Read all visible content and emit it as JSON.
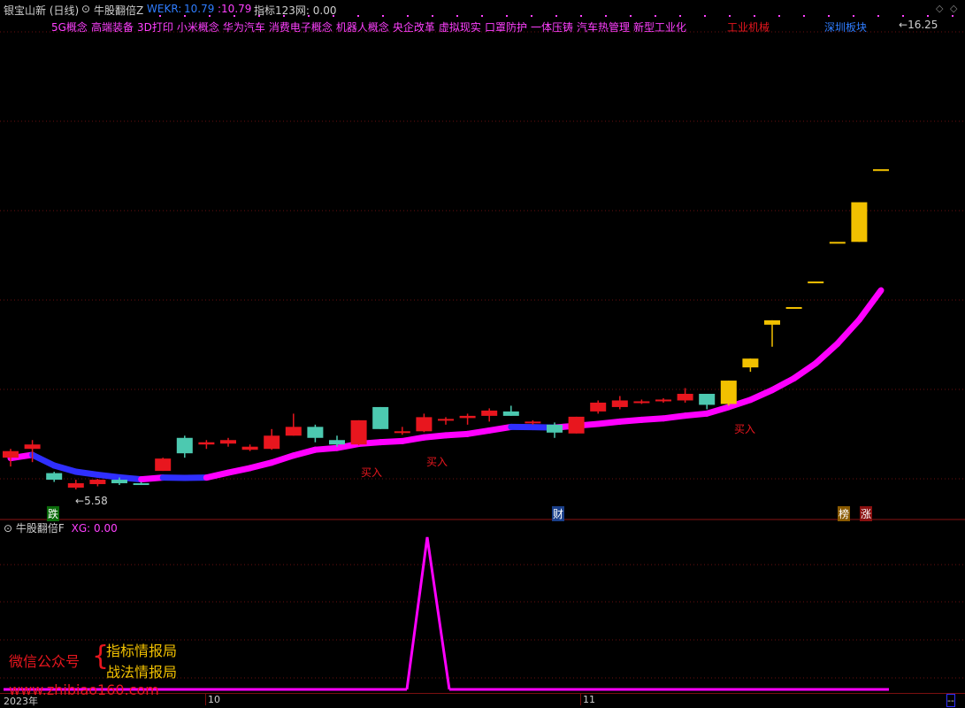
{
  "header": {
    "title": "银宝山新 (日线)",
    "indicator": "牛股翻倍Z",
    "wekr_label": "WEKR:",
    "wekr_value": "10.79",
    "wekr_value2": ":10.79",
    "zb_label": "指标123网: 0.00"
  },
  "concepts": [
    "5G概念",
    "高端装备",
    "3D打印",
    "小米概念",
    "华为汽车",
    "消费电子概念",
    "机器人概念",
    "央企改革",
    "虚拟现实",
    "口罩防护",
    "一体压铸",
    "汽车热管理",
    "新型工业化"
  ],
  "concepts_right": [
    "工业机械",
    "深圳板块"
  ],
  "sub_header": {
    "indicator": "牛股翻倍F",
    "xg_label": "XG:",
    "xg_value": "0.00"
  },
  "markers": {
    "high": "16.25",
    "low": "5.58",
    "buy": "买入",
    "die": "跌",
    "cai": "财",
    "bang": "榜",
    "zhang": "涨"
  },
  "axis": {
    "year": "2023年",
    "m10": "10",
    "m11": "11",
    "end": "--"
  },
  "watermark": {
    "wechat": "微信公众号",
    "brace": "{",
    "line1": "指标情报局",
    "line2": "战法情报局",
    "url": "www.zhibiao160.com"
  },
  "colors": {
    "up": "#e8161e",
    "down": "#4cc9b0",
    "gold": "#f2c100",
    "blue": "#2f2fff",
    "magenta": "#ff00ff",
    "grid": "#7a1010",
    "bg": "#000000"
  },
  "chart_data": {
    "type": "candlestick",
    "series_candles": [
      {
        "o": 6.3,
        "h": 6.5,
        "l": 6.1,
        "c": 6.45
      },
      {
        "o": 6.5,
        "h": 6.7,
        "l": 6.2,
        "c": 6.6
      },
      {
        "o": 5.95,
        "h": 5.98,
        "l": 5.75,
        "c": 5.8
      },
      {
        "o": 5.62,
        "h": 5.8,
        "l": 5.58,
        "c": 5.72
      },
      {
        "o": 5.7,
        "h": 5.82,
        "l": 5.65,
        "c": 5.8
      },
      {
        "o": 5.8,
        "h": 5.85,
        "l": 5.68,
        "c": 5.72
      },
      {
        "o": 5.72,
        "h": 5.75,
        "l": 5.68,
        "c": 5.7
      },
      {
        "o": 6.0,
        "h": 6.3,
        "l": 6.0,
        "c": 6.28
      },
      {
        "o": 6.75,
        "h": 6.8,
        "l": 6.3,
        "c": 6.4
      },
      {
        "o": 6.6,
        "h": 6.7,
        "l": 6.5,
        "c": 6.65
      },
      {
        "o": 6.62,
        "h": 6.75,
        "l": 6.55,
        "c": 6.7
      },
      {
        "o": 6.48,
        "h": 6.6,
        "l": 6.45,
        "c": 6.55
      },
      {
        "o": 6.5,
        "h": 6.95,
        "l": 6.48,
        "c": 6.8
      },
      {
        "o": 6.8,
        "h": 7.3,
        "l": 6.8,
        "c": 7.0
      },
      {
        "o": 7.0,
        "h": 7.05,
        "l": 6.65,
        "c": 6.75
      },
      {
        "o": 6.7,
        "h": 6.8,
        "l": 6.55,
        "c": 6.6
      },
      {
        "o": 6.6,
        "h": 7.15,
        "l": 6.58,
        "c": 7.15
      },
      {
        "o": 7.45,
        "h": 7.45,
        "l": 6.95,
        "c": 6.95
      },
      {
        "o": 6.88,
        "h": 7.0,
        "l": 6.82,
        "c": 6.9
      },
      {
        "o": 6.9,
        "h": 7.3,
        "l": 6.88,
        "c": 7.22
      },
      {
        "o": 7.15,
        "h": 7.22,
        "l": 7.05,
        "c": 7.18
      },
      {
        "o": 7.2,
        "h": 7.3,
        "l": 7.05,
        "c": 7.25
      },
      {
        "o": 7.25,
        "h": 7.42,
        "l": 7.12,
        "c": 7.37
      },
      {
        "o": 7.35,
        "h": 7.48,
        "l": 7.25,
        "c": 7.25
      },
      {
        "o": 7.1,
        "h": 7.15,
        "l": 7.05,
        "c": 7.12
      },
      {
        "o": 7.05,
        "h": 7.1,
        "l": 6.75,
        "c": 6.87
      },
      {
        "o": 6.85,
        "h": 7.23,
        "l": 6.85,
        "c": 7.23
      },
      {
        "o": 7.35,
        "h": 7.6,
        "l": 7.3,
        "c": 7.55
      },
      {
        "o": 7.45,
        "h": 7.7,
        "l": 7.4,
        "c": 7.6
      },
      {
        "o": 7.58,
        "h": 7.62,
        "l": 7.52,
        "c": 7.58
      },
      {
        "o": 7.6,
        "h": 7.65,
        "l": 7.55,
        "c": 7.62
      },
      {
        "o": 7.6,
        "h": 7.88,
        "l": 7.55,
        "c": 7.75
      },
      {
        "o": 7.75,
        "h": 7.75,
        "l": 7.4,
        "c": 7.5
      },
      {
        "o": 7.52,
        "h": 8.05,
        "l": 7.48,
        "c": 8.05
      },
      {
        "o": 8.35,
        "h": 8.55,
        "l": 8.25,
        "c": 8.55
      },
      {
        "o": 9.42,
        "h": 9.42,
        "l": 8.82,
        "c": 9.32
      },
      {
        "o": 9.72,
        "h": 9.72,
        "l": 9.72,
        "c": 9.72
      },
      {
        "o": 10.3,
        "h": 10.3,
        "l": 10.3,
        "c": 10.3
      },
      {
        "o": 11.2,
        "h": 11.2,
        "l": 11.2,
        "c": 11.2
      },
      {
        "o": 11.2,
        "h": 12.1,
        "l": 11.2,
        "c": 12.1
      },
      {
        "o": 12.85,
        "h": 12.85,
        "l": 12.85,
        "c": 12.85
      }
    ],
    "xg_signal": [
      0,
      0,
      0,
      0,
      0,
      0,
      0,
      0,
      0,
      0,
      0,
      0,
      0,
      0,
      0,
      0,
      0,
      0,
      0,
      1,
      0,
      0,
      0,
      0,
      0,
      0,
      0,
      0,
      0,
      0,
      0,
      0,
      0,
      0,
      0,
      0,
      0,
      0,
      0,
      0,
      0
    ],
    "annotations": [
      "16.25",
      "5.58",
      "买入",
      "买入",
      "买入"
    ]
  }
}
